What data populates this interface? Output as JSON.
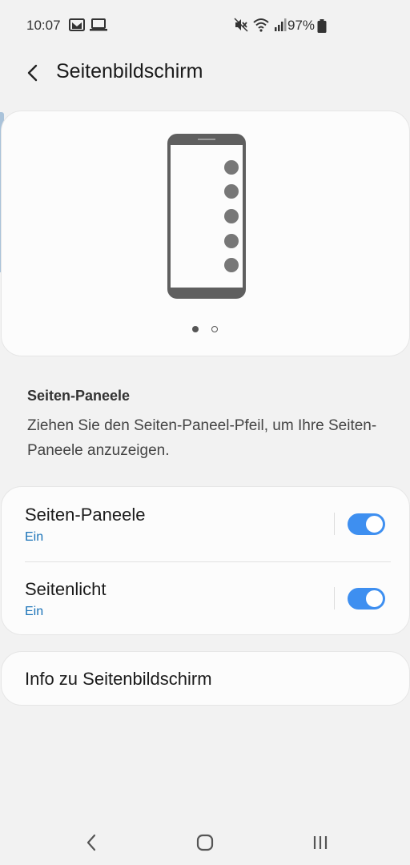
{
  "status_bar": {
    "time": "10:07",
    "battery": "97%",
    "left_icons": [
      "gmail-icon",
      "laptop-icon"
    ],
    "right_icons": [
      "mute-icon",
      "wifi-icon",
      "signal-icon",
      "battery-icon"
    ]
  },
  "header": {
    "title": "Seitenbildschirm",
    "back_icon": "back-arrow-icon"
  },
  "preview": {
    "pager_dots": 2,
    "active_dot": 0
  },
  "description": {
    "title": "Seiten-Paneele",
    "text": "Ziehen Sie den Seiten-Paneel-Pfeil, um Ihre Seiten-Paneele anzuzeigen."
  },
  "settings": [
    {
      "title": "Seiten-Paneele",
      "status": "Ein",
      "enabled": true
    },
    {
      "title": "Seitenlicht",
      "status": "Ein",
      "enabled": true
    }
  ],
  "info": {
    "label": "Info zu Seitenbildschirm"
  },
  "colors": {
    "accent": "#3e8ff0",
    "status_text": "#1a73b8",
    "background": "#f2f2f2",
    "card": "#fcfcfc"
  }
}
